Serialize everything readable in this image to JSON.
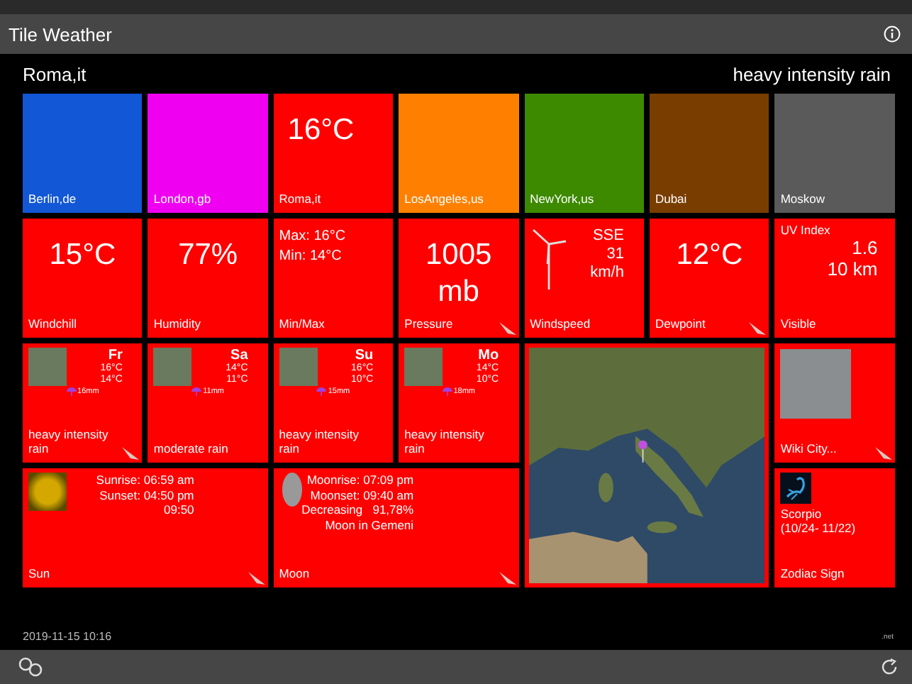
{
  "header": {
    "title": "Tile Weather"
  },
  "location": {
    "city": "Roma,it",
    "condition": "heavy intensity rain"
  },
  "cities": [
    {
      "name": "Berlin,de",
      "color": "#1157d6"
    },
    {
      "name": "London,gb",
      "color": "#f000f0"
    },
    {
      "name": "Roma,it",
      "value": "16°C",
      "color": "#ff0000"
    },
    {
      "name": "LosAngeles,us",
      "color": "#ff8000"
    },
    {
      "name": "NewYork,us",
      "color": "#3d8a00"
    },
    {
      "name": "Dubai",
      "color": "#7a3d00"
    },
    {
      "name": "Moskow",
      "color": "#5a5a5a"
    }
  ],
  "details": [
    {
      "kind": "big",
      "label": "Windchill",
      "lines": [
        "15°C"
      ],
      "feather": false
    },
    {
      "kind": "big",
      "label": "Humidity",
      "lines": [
        "77%"
      ],
      "feather": false
    },
    {
      "kind": "small",
      "label": "Min/Max",
      "lines": [
        "Max: 16°C",
        "Min: 14°C"
      ],
      "feather": false
    },
    {
      "kind": "big",
      "label": "Pressure",
      "lines": [
        "1005",
        "mb"
      ],
      "feather": true
    },
    {
      "kind": "wind",
      "label": "Windspeed",
      "lines": [
        "SSE",
        "31",
        "km/h"
      ],
      "feather": false
    },
    {
      "kind": "big",
      "label": "Dewpoint",
      "lines": [
        "12°C"
      ],
      "feather": true
    },
    {
      "kind": "uv",
      "label": "Visible",
      "title": "UV Index",
      "lines": [
        "1.6",
        "10 km"
      ],
      "feather": false
    }
  ],
  "forecast": [
    {
      "day": "Fr",
      "high": "16°C",
      "low": "14°C",
      "rain": "16mm",
      "description": "heavy intensity rain",
      "feather": true
    },
    {
      "day": "Sa",
      "high": "14°C",
      "low": "11°C",
      "rain": "11mm",
      "description": "moderate rain",
      "feather": false
    },
    {
      "day": "Su",
      "high": "16°C",
      "low": "10°C",
      "rain": "15mm",
      "description": "heavy intensity rain",
      "feather": false
    },
    {
      "day": "Mo",
      "high": "14°C",
      "low": "10°C",
      "rain": "18mm",
      "description": "heavy intensity rain",
      "feather": false
    }
  ],
  "sun": {
    "label": "Sun",
    "lines": [
      "Sunrise: 06:59 am",
      "Sunset: 04:50 pm",
      "09:50"
    ]
  },
  "moon": {
    "label": "Moon",
    "lines": [
      "Moonrise: 07:09 pm",
      "Moonset: 09:40 am",
      "Decreasing   91,78%",
      "Moon in Gemeni"
    ]
  },
  "wiki": {
    "label": "Wiki City..."
  },
  "zodiac": {
    "sign": "Scorpio",
    "dates": "(10/24- 11/22)",
    "label": "Zodiac Sign"
  },
  "footer": {
    "timestamp": "2019-11-15 10:16",
    "note": ".net"
  }
}
